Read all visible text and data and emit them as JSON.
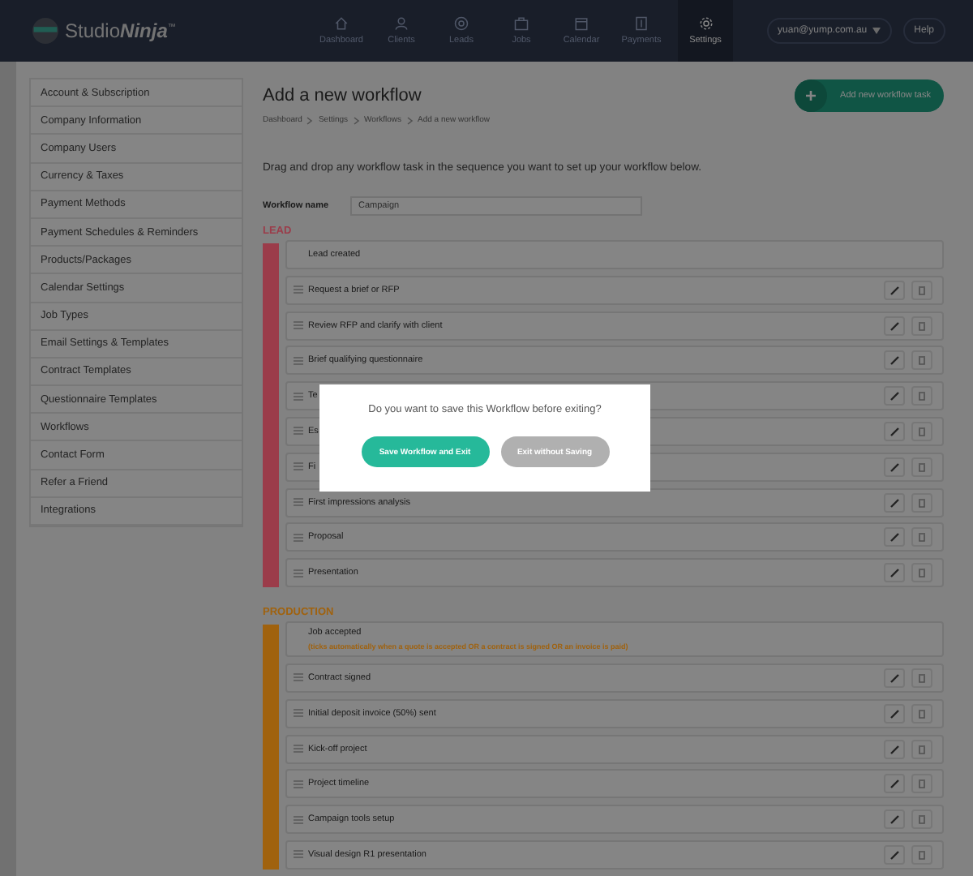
{
  "nav": {
    "logo_text": "Studio",
    "logo_bold": "Ninja",
    "logo_mark": "™",
    "items": [
      {
        "label": "Dashboard",
        "selected": false
      },
      {
        "label": "Clients",
        "selected": false
      },
      {
        "label": "Leads",
        "selected": false
      },
      {
        "label": "Jobs",
        "selected": false
      },
      {
        "label": "Calendar",
        "selected": false
      },
      {
        "label": "Payments",
        "selected": false
      },
      {
        "label": "Settings",
        "selected": true
      }
    ],
    "user": "yuan@yump.com.au",
    "help": "Help"
  },
  "sidebar": {
    "items": [
      "Account & Subscription",
      "Company Information",
      "Company Users",
      "Currency & Taxes",
      "Payment Methods",
      "Payment Schedules & Reminders",
      "Products/Packages",
      "Calendar Settings",
      "Job Types",
      "Email Settings & Templates",
      "Contract Templates",
      "Questionnaire Templates",
      "Workflows",
      "Contact Form",
      "Refer a Friend",
      "Integrations"
    ]
  },
  "page": {
    "title": "Add a new workflow",
    "breadcrumb": [
      "Dashboard",
      "Settings",
      "Workflows",
      "Add a new workflow"
    ],
    "add_button": "Add new workflow task",
    "instruction": "Drag and drop any workflow task in the sequence you want to set up your workflow below.",
    "name_label": "Workflow name",
    "name_value": "Campaign"
  },
  "stages": [
    {
      "title": "LEAD",
      "color": "#9b3c4a",
      "tasks": [
        {
          "kind": "fixed",
          "name": "Lead created"
        },
        {
          "kind": "task",
          "name": "Request a brief or RFP"
        },
        {
          "kind": "task",
          "name": "Review RFP and clarify with client"
        },
        {
          "kind": "task",
          "name": "Brief qualifying questionnaire"
        },
        {
          "kind": "task",
          "name": "Te"
        },
        {
          "kind": "task",
          "name": "Es"
        },
        {
          "kind": "task",
          "name": "Fi"
        },
        {
          "kind": "task",
          "name": "First impressions analysis"
        },
        {
          "kind": "task",
          "name": "Proposal"
        },
        {
          "kind": "task",
          "name": "Presentation"
        }
      ]
    },
    {
      "title": "PRODUCTION",
      "color": "#a0620e",
      "tasks": [
        {
          "kind": "fixed",
          "name": "Job accepted",
          "note": "(ticks automatically when a quote is accepted OR a contract is signed OR an invoice is paid)"
        },
        {
          "kind": "task",
          "name": "Contract signed"
        },
        {
          "kind": "task",
          "name": "Initial deposit invoice (50%) sent"
        },
        {
          "kind": "task",
          "name": "Kick-off project"
        },
        {
          "kind": "task",
          "name": "Project timeline"
        },
        {
          "kind": "task",
          "name": "Campaign tools setup"
        },
        {
          "kind": "task",
          "name": "Visual design R1 presentation"
        }
      ]
    }
  ],
  "dialog": {
    "message": "Do you want to save this Workflow before exiting?",
    "buttons": [
      {
        "label": "Save Workflow and Exit",
        "kind": "primary"
      },
      {
        "label": "Exit without Saving",
        "kind": "secondary"
      }
    ]
  }
}
